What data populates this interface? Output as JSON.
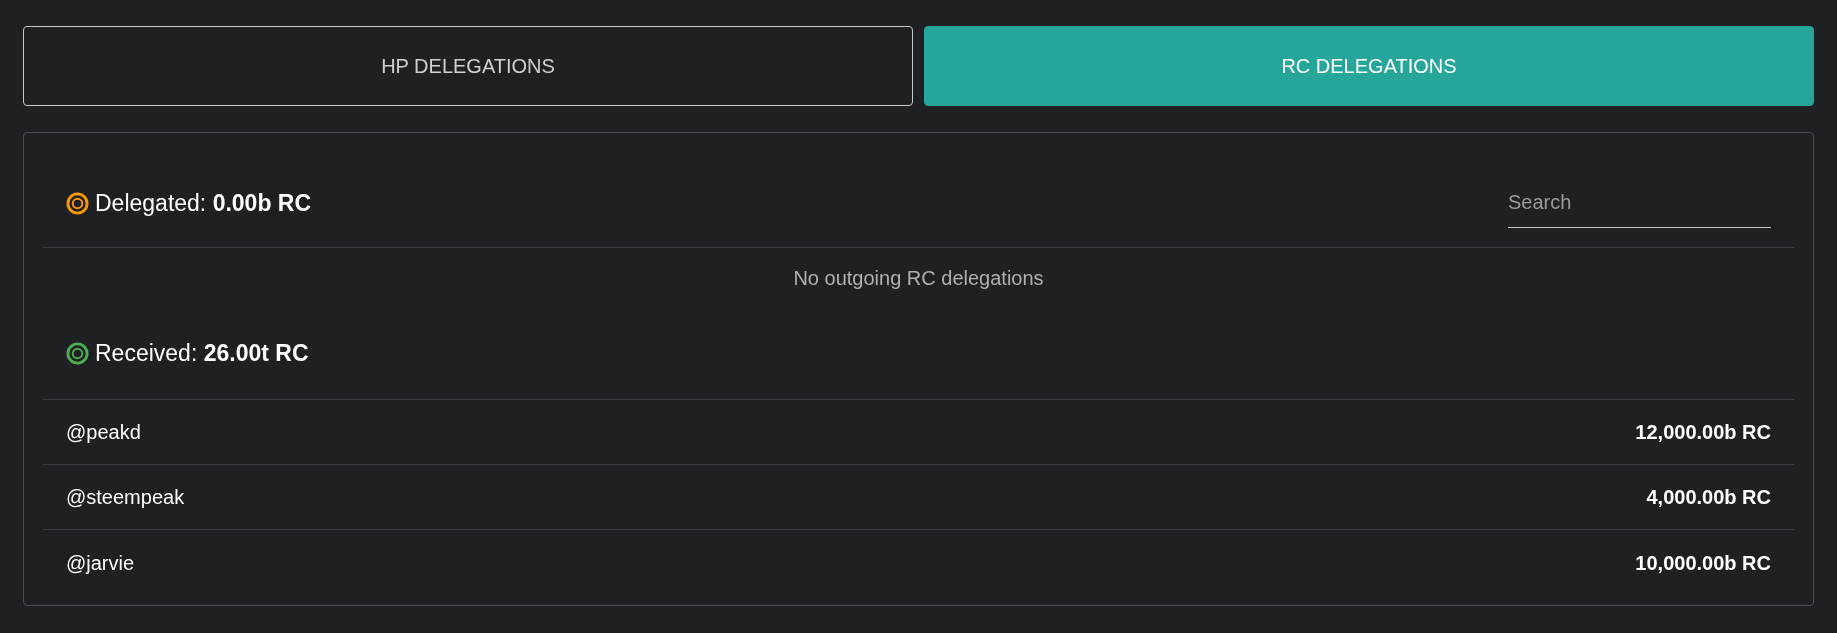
{
  "tabs": [
    {
      "label": "HP DELEGATIONS",
      "selected": false
    },
    {
      "label": "RC DELEGATIONS",
      "selected": true
    }
  ],
  "sections": [
    {
      "title": "Delegated: **0.00b RC**",
      "color": "#ff9800",
      "search": {
        "placeholder": "Search"
      },
      "empty_message": "No outgoing RC delegations"
    },
    {
      "title": "Received: **26.00t RC**",
      "color": "#4caf50",
      "rows": [
        {
          "account": "@peakd",
          "amount": "12,000.00b RC"
        },
        {
          "account": "@steempeak",
          "amount": "4,000.00b RC"
        },
        {
          "account": "@jarvie",
          "amount": "10,000.00b RC"
        }
      ]
    }
  ]
}
